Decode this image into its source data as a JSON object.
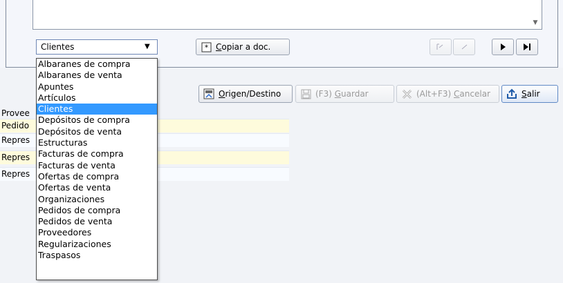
{
  "memo": {
    "scroll_down_icon": "chevron-down-icon"
  },
  "doc_combo": {
    "value": "Clientes"
  },
  "copy_button": {
    "label": "Copiar a doc.",
    "mnemonic": "C",
    "rest": "opiar a doc."
  },
  "nav": {
    "first_icon": "first-page-icon",
    "prev_icon": "prev-page-icon",
    "next_icon": "next-page-icon",
    "last_icon": "last-page-icon"
  },
  "actions": {
    "origin": {
      "mnemonic": "O",
      "rest": "rigen/Destino"
    },
    "save": {
      "prefix": "(F3) ",
      "mnemonic": "G",
      "rest": "uardar"
    },
    "cancel": {
      "prefix": "(Alt+F3) ",
      "mnemonic": "C",
      "rest": "ancelar"
    },
    "exit": {
      "mnemonic": "S",
      "rest": "alir"
    }
  },
  "grid": {
    "rows": [
      {
        "label": "Provee"
      },
      {
        "label": "Pedido"
      },
      {
        "label": "Repres"
      },
      {
        "label": "Repres"
      },
      {
        "label": "Repres"
      }
    ]
  },
  "doc_list": {
    "selected": "Clientes",
    "items": [
      "Albaranes de compra",
      "Albaranes de venta",
      "Apuntes",
      "Artículos",
      "Clientes",
      "Depósitos de compra",
      "Depósitos de venta",
      "Estructuras",
      "Facturas de compra",
      "Facturas de venta",
      "Ofertas de compra",
      "Ofertas de venta",
      "Organizaciones",
      "Pedidos de compra",
      "Pedidos de venta",
      "Proveedores",
      "Regularizaciones",
      "Traspasos"
    ]
  },
  "colors": {
    "selection": "#3399ff",
    "row_highlight": "#fefbdc",
    "row_alt": "#f8fbff",
    "background": "#f1f3f7"
  }
}
